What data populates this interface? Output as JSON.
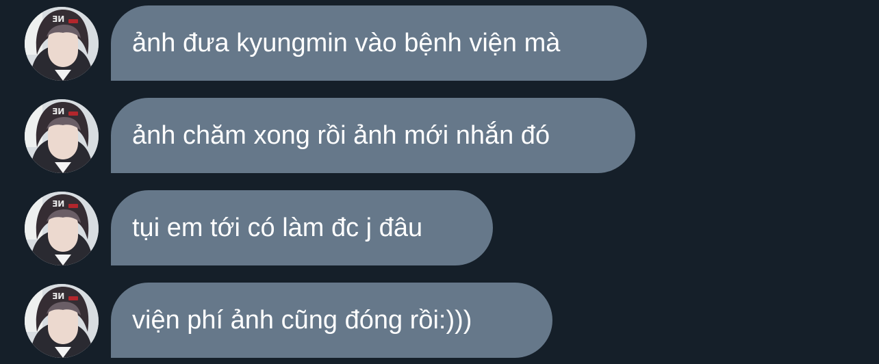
{
  "conversation": {
    "messages": [
      {
        "text": "ảnh đưa kyungmin vào bệnh viện mà",
        "avatar_icon": "user-avatar"
      },
      {
        "text": "ảnh chăm xong rồi ảnh mới nhắn đó",
        "avatar_icon": "user-avatar"
      },
      {
        "text": "tụi em tới có làm đc j đâu",
        "avatar_icon": "user-avatar"
      },
      {
        "text": "viện phí ảnh cũng đóng rồi:)))",
        "avatar_icon": "user-avatar"
      }
    ]
  },
  "colors": {
    "background": "#151f29",
    "bubble": "#66788a",
    "text": "#ffffff"
  }
}
